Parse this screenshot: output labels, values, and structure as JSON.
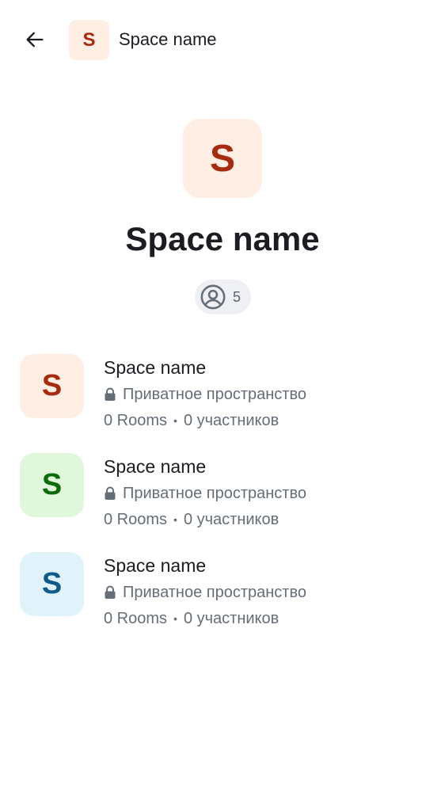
{
  "header": {
    "title": "Space name",
    "avatar_letter": "S",
    "avatar_bg": "#ffeee3",
    "avatar_fg": "#a62a0d"
  },
  "hero": {
    "avatar_letter": "S",
    "avatar_bg": "#ffeee3",
    "avatar_fg": "#a62a0d",
    "title": "Space name",
    "member_count": "5"
  },
  "spaces": [
    {
      "letter": "S",
      "bg": "#ffeee3",
      "fg": "#a62a0d",
      "name": "Space name",
      "privacy": "Приватное пространство",
      "rooms": "0 Rooms",
      "separator": "•",
      "members": "0 участников"
    },
    {
      "letter": "S",
      "bg": "#e1f7dc",
      "fg": "#0b6b07",
      "name": "Space name",
      "privacy": "Приватное пространство",
      "rooms": "0 Rooms",
      "separator": "•",
      "members": "0 участников"
    },
    {
      "letter": "S",
      "bg": "#e0f2fa",
      "fg": "#0e5b8c",
      "name": "Space name",
      "privacy": "Приватное пространство",
      "rooms": "0 Rooms",
      "separator": "•",
      "members": "0 участников"
    }
  ]
}
